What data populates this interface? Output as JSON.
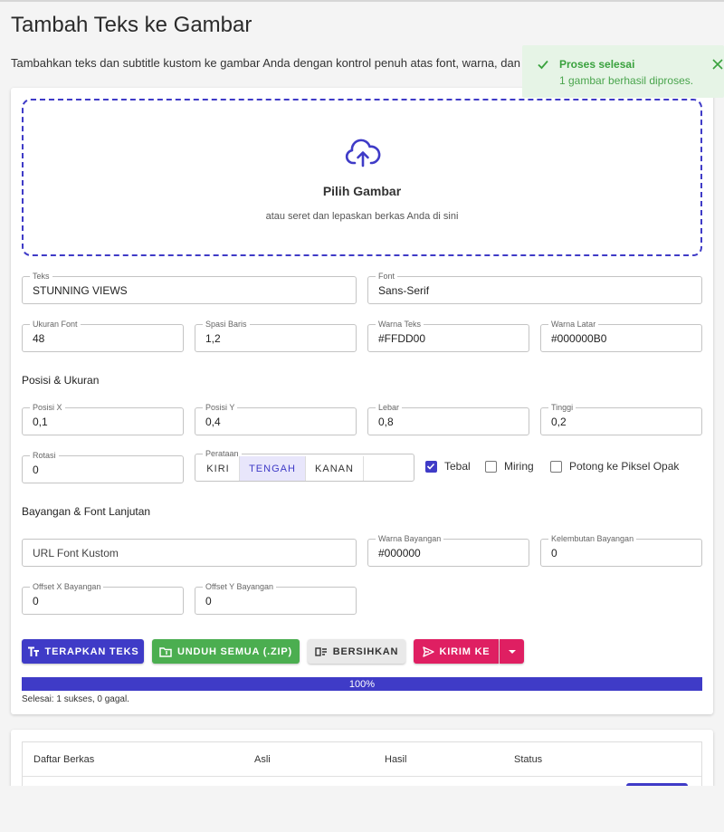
{
  "page": {
    "title": "Tambah Teks ke Gambar",
    "description": "Tambahkan teks dan subtitle kustom ke gambar Anda dengan kontrol penuh atas font, warna, dan posisi."
  },
  "toast": {
    "title": "Proses selesai",
    "message": "1 gambar berhasil diproses.",
    "icon": "check-icon",
    "close_icon": "close-icon"
  },
  "dropzone": {
    "icon": "cloud-upload-icon",
    "title": "Pilih Gambar",
    "subtitle": "atau seret dan lepaskan berkas Anda di sini"
  },
  "fields": {
    "text": {
      "label": "Teks",
      "value": "STUNNING VIEWS"
    },
    "font": {
      "label": "Font",
      "value": "Sans-Serif"
    },
    "font_size": {
      "label": "Ukuran Font",
      "value": "48"
    },
    "line_spacing": {
      "label": "Spasi Baris",
      "value": "1,2"
    },
    "text_color": {
      "label": "Warna Teks",
      "value": "#FFDD00"
    },
    "bg_color": {
      "label": "Warna Latar",
      "value": "#000000B0"
    },
    "pos_x": {
      "label": "Posisi X",
      "value": "0,1"
    },
    "pos_y": {
      "label": "Posisi Y",
      "value": "0,4"
    },
    "width": {
      "label": "Lebar",
      "value": "0,8"
    },
    "height": {
      "label": "Tinggi",
      "value": "0,2"
    },
    "rotation": {
      "label": "Rotasi",
      "value": "0"
    },
    "custom_font_url": {
      "placeholder": "URL Font Kustom"
    },
    "shadow_color": {
      "label": "Warna Bayangan",
      "value": "#000000"
    },
    "shadow_softness": {
      "label": "Kelembutan Bayangan",
      "value": "0"
    },
    "shadow_offset_x": {
      "label": "Offset X Bayangan",
      "value": "0"
    },
    "shadow_offset_y": {
      "label": "Offset Y Bayangan",
      "value": "0"
    }
  },
  "sections": {
    "position": "Posisi & Ukuran",
    "shadow": "Bayangan & Font Lanjutan"
  },
  "alignment": {
    "label": "Perataan",
    "options": [
      "KIRI",
      "TENGAH",
      "KANAN"
    ],
    "selected": "TENGAH"
  },
  "checkboxes": {
    "bold": {
      "label": "Tebal",
      "checked": true
    },
    "italic": {
      "label": "Miring",
      "checked": false
    },
    "crop": {
      "label": "Potong ke Piksel Opak",
      "checked": false
    }
  },
  "buttons": {
    "apply": "TERAPKAN TEKS",
    "download_all": "UNDUH SEMUA (.ZIP)",
    "clear": "BERSIHKAN",
    "send_to": "KIRIM KE"
  },
  "progress": {
    "percent_label": "100%",
    "value": 1.0,
    "status": "Selesai: 1 sukses, 0 gagal."
  },
  "table": {
    "headers": [
      "Daftar Berkas",
      "Asli",
      "Hasil",
      "Status"
    ]
  },
  "colors": {
    "accent": "#3f3bc7",
    "success": "#4bae50",
    "danger": "#df1f62",
    "toast_bg": "#e6f4e6"
  }
}
